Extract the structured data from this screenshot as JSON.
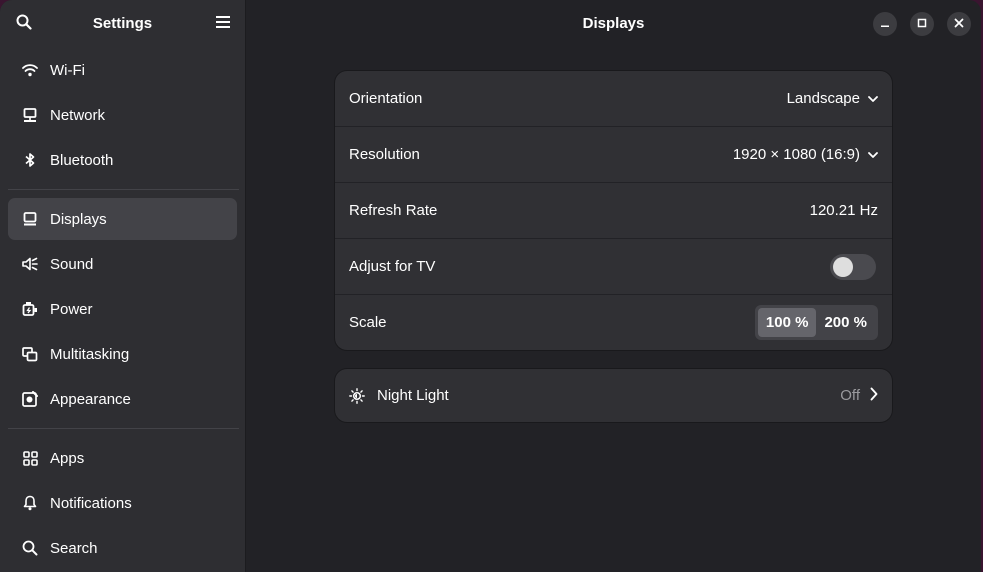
{
  "sidebar": {
    "title": "Settings",
    "groups": [
      [
        {
          "label": "Wi-Fi",
          "icon": "wifi-icon"
        },
        {
          "label": "Network",
          "icon": "network-icon"
        },
        {
          "label": "Bluetooth",
          "icon": "bluetooth-icon"
        }
      ],
      [
        {
          "label": "Displays",
          "icon": "display-icon",
          "active": true
        },
        {
          "label": "Sound",
          "icon": "sound-icon"
        },
        {
          "label": "Power",
          "icon": "power-icon"
        },
        {
          "label": "Multitasking",
          "icon": "multitasking-icon"
        },
        {
          "label": "Appearance",
          "icon": "appearance-icon"
        }
      ],
      [
        {
          "label": "Apps",
          "icon": "apps-icon"
        },
        {
          "label": "Notifications",
          "icon": "bell-icon"
        },
        {
          "label": "Search",
          "icon": "search-icon"
        }
      ]
    ]
  },
  "main": {
    "title": "Displays",
    "orientation": {
      "label": "Orientation",
      "value": "Landscape"
    },
    "resolution": {
      "label": "Resolution",
      "value": "1920 × 1080 (16:9)"
    },
    "refresh_rate": {
      "label": "Refresh Rate",
      "value": "120.21 Hz"
    },
    "adjust_tv": {
      "label": "Adjust for TV",
      "enabled": false
    },
    "scale": {
      "label": "Scale",
      "options": [
        "100 %",
        "200 %"
      ],
      "selected": "100 %"
    },
    "night_light": {
      "label": "Night Light",
      "value": "Off"
    }
  },
  "colors": {
    "window_bg": "#222226",
    "sidebar_bg": "#2e2e32",
    "card_bg": "#303034",
    "active_item": "#434348",
    "backdrop": "#3a1530"
  }
}
